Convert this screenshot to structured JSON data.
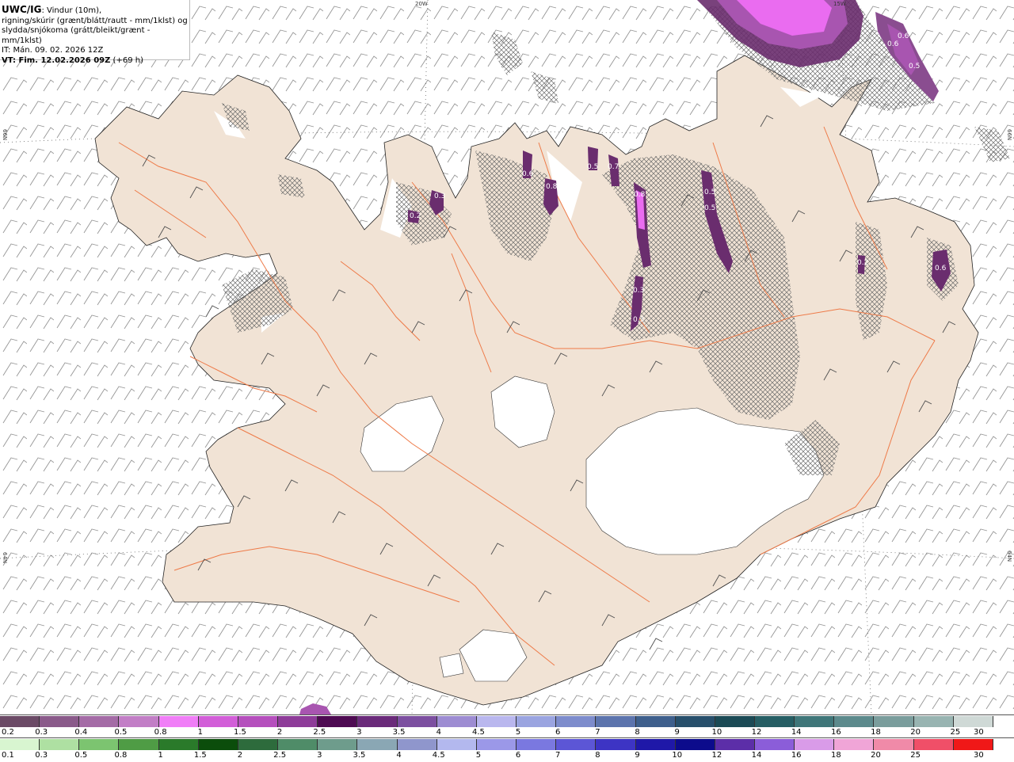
{
  "header": {
    "title_bold": "UWC/IG",
    "title_rest": ": Vindur (10m),",
    "line2": "rigning/skúrir (grænt/blátt/rautt - mm/1klst) og",
    "line3": "slydda/snjókoma (grátt/bleikt/grænt - mm/1klst)",
    "line4": "IT: Mán. 09. 02. 2026 12Z",
    "line5_bold": "VT: Fim. 12.02.2026 09Z",
    "line5_rest": " (+69 h)"
  },
  "coordinates": {
    "top_left_lon": "20W",
    "top_right_lon": "15W",
    "left_upper_lat": "66N",
    "left_lower_lat": "64N",
    "right_upper_lat": "66N",
    "right_lower_lat": "64N"
  },
  "precip_labels": [
    {
      "text": "0.6"
    },
    {
      "text": "0.6"
    },
    {
      "text": "0.5"
    },
    {
      "text": "0.3"
    },
    {
      "text": "0.2"
    },
    {
      "text": "0.6"
    },
    {
      "text": "0.8"
    },
    {
      "text": "0.5"
    },
    {
      "text": "0.7"
    },
    {
      "text": "0.8"
    },
    {
      "text": "0.5"
    },
    {
      "text": "0.5"
    },
    {
      "text": "0.3"
    },
    {
      "text": "0.3"
    },
    {
      "text": "0.2"
    },
    {
      "text": "0.6"
    }
  ],
  "colors": {
    "land": "#f1e3d5",
    "sea": "#ffffff",
    "roads": "#f07040",
    "hatch": "#777777",
    "snow_purple_dark": "#6a2d6e",
    "snow_purple_mid": "#a855b0",
    "snow_magenta": "#ea6cf0"
  },
  "snow_scale": {
    "labels": [
      "0.2",
      "0.3",
      "0.4",
      "0.5",
      "0.8",
      "1",
      "1.5",
      "2",
      "2.5",
      "3",
      "3.5",
      "4",
      "4.5",
      "5",
      "6",
      "7",
      "8",
      "9",
      "10",
      "12",
      "14",
      "16",
      "18",
      "20",
      "25",
      "30"
    ],
    "colors": [
      "#6b4a66",
      "#8a5a8a",
      "#a46ba6",
      "#c27ec6",
      "#f07ef7",
      "#d25ed8",
      "#b54fbd",
      "#8e3c99",
      "#4e0a52",
      "#6a2a7a",
      "#7c4fa0",
      "#9d8cd2",
      "#b9b7ee",
      "#9aa4e0",
      "#7d8ccc",
      "#5c74ad",
      "#3e5f8c",
      "#274f6b",
      "#1b4a55",
      "#265e64",
      "#3f7679",
      "#5c8a8c",
      "#7a9d9c",
      "#98b4b1",
      "#cfd9d6"
    ]
  },
  "rain_scale": {
    "labels": [
      "0.1",
      "0.3",
      "0.5",
      "0.8",
      "1",
      "1.5",
      "2",
      "2.5",
      "3",
      "3.5",
      "4",
      "4.5",
      "5",
      "6",
      "7",
      "8",
      "9",
      "10",
      "12",
      "14",
      "16",
      "18",
      "20",
      "25",
      "30"
    ],
    "colors": [
      "#d8f5d0",
      "#aee0a2",
      "#7cc470",
      "#4f9c45",
      "#2a7a2a",
      "#0b4d0b",
      "#2d6b3c",
      "#4f8c68",
      "#6e9c8c",
      "#8aa7b4",
      "#8f96cc",
      "#b3b8ee",
      "#9b98e8",
      "#7a78e0",
      "#5c56d6",
      "#3d34c4",
      "#1f18a8",
      "#0c0b8c",
      "#5c2ea8",
      "#8b5dd9",
      "#d99be8",
      "#f0a5d7",
      "#f08aa8",
      "#f04f68",
      "#f01818"
    ]
  }
}
